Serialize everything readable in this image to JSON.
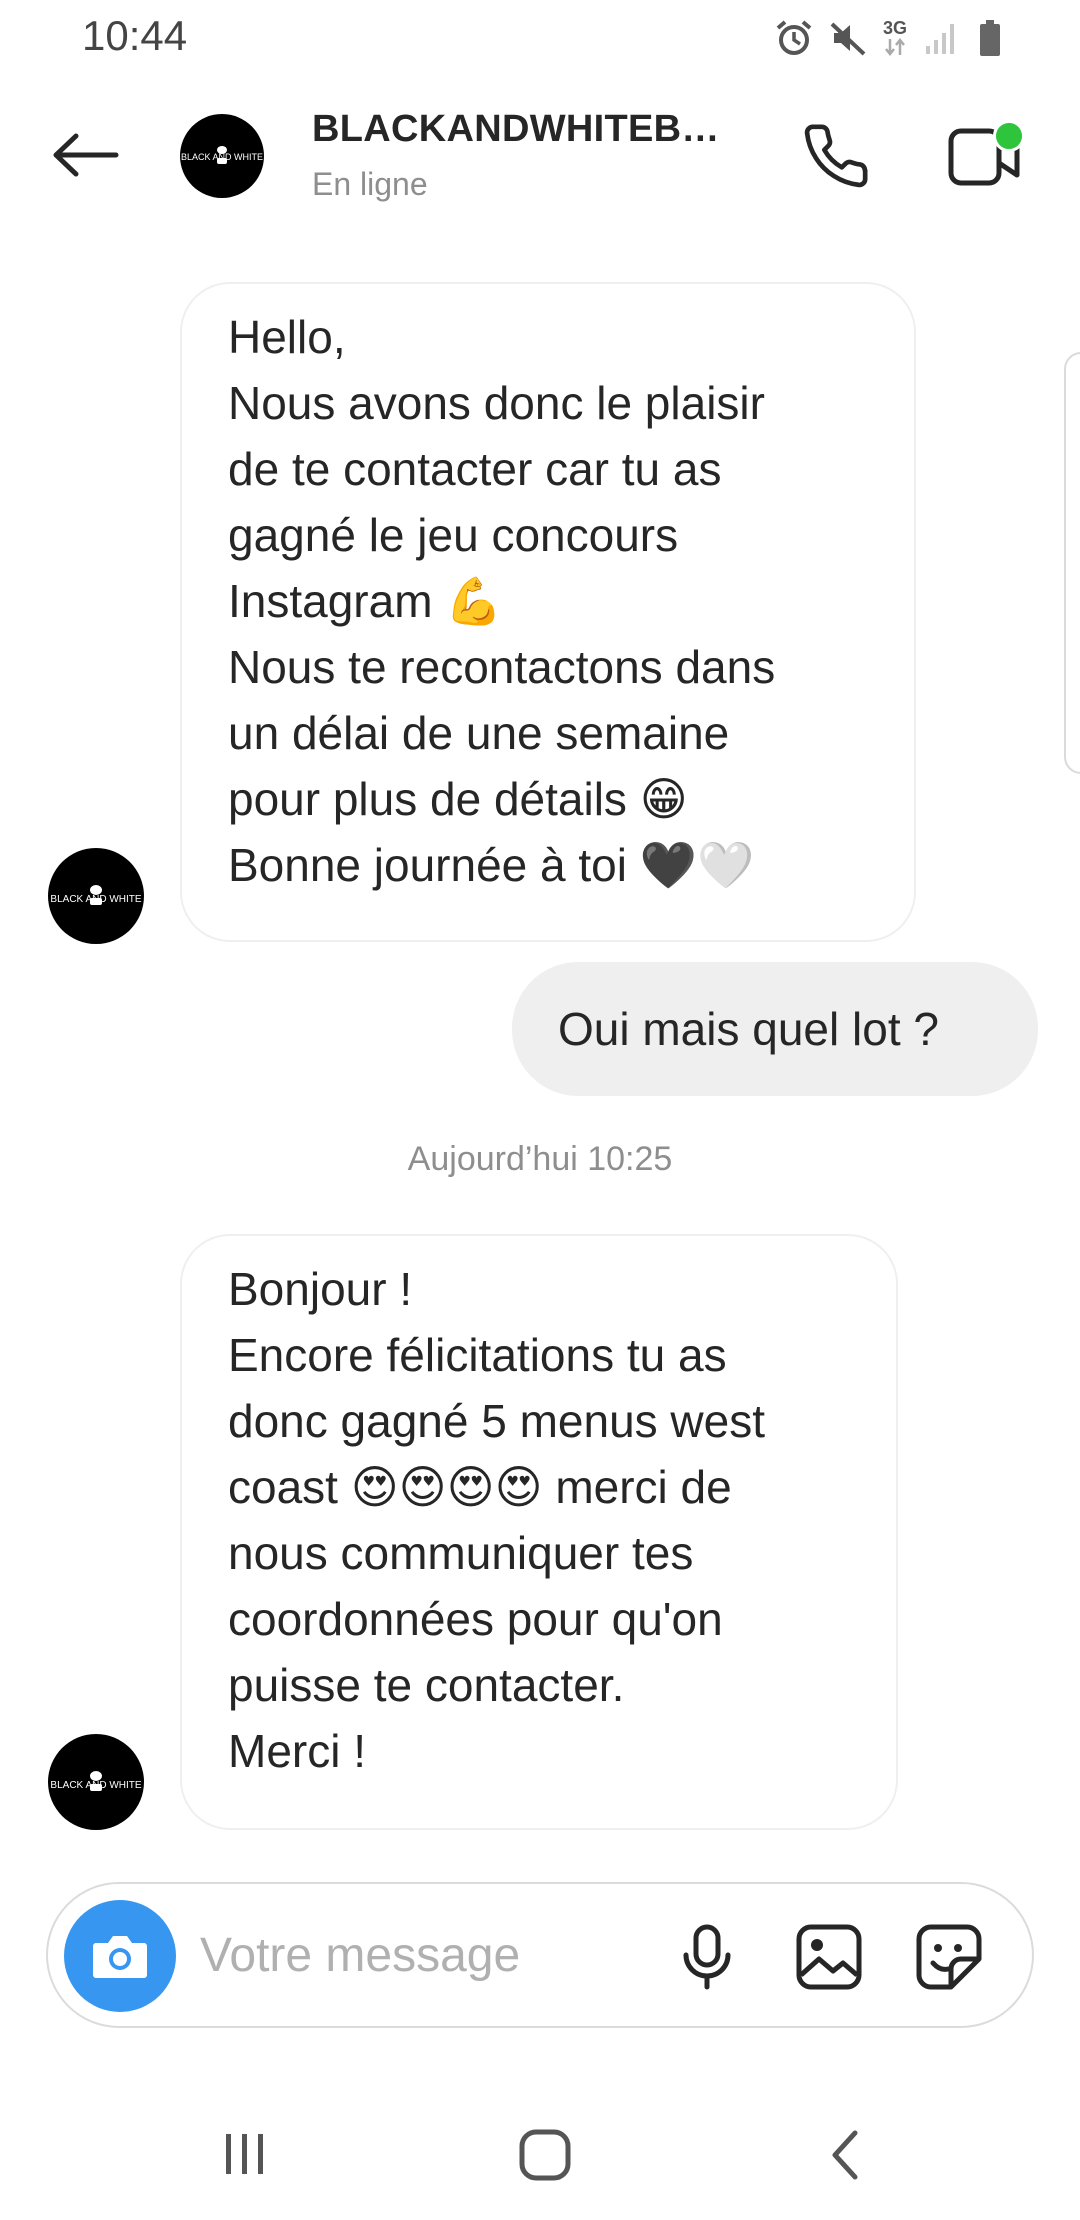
{
  "status_bar": {
    "time": "10:44",
    "network": "3G",
    "icons": [
      "alarm-icon",
      "mute-icon",
      "network-3g-icon",
      "signal-icon",
      "battery-icon"
    ]
  },
  "header": {
    "name": "BLACKANDWHITEB…",
    "status": "En ligne",
    "avatar_label": "BLACK AND WHITE",
    "icons": [
      "back-arrow-icon",
      "phone-icon",
      "video-camera-icon"
    ],
    "online_color": "#2ec43c"
  },
  "messages": [
    {
      "sender": "contact",
      "lines": [
        "Hello,",
        "Nous avons donc le plaisir",
        "de te contacter car tu as",
        "gagné le jeu concours",
        "Instagram 💪",
        "Nous te recontactons dans",
        "un délai de une semaine",
        "pour plus de détails 😁",
        "Bonne journée à toi 🖤🤍"
      ]
    },
    {
      "sender": "me",
      "text": "Oui mais quel lot ?"
    },
    {
      "sender": "contact",
      "lines": [
        "Bonjour !",
        "Encore félicitations tu as",
        "donc gagné 5 menus west",
        "coast 😍😍😍😍 merci de",
        "nous communiquer tes",
        "coordonnées  pour qu'on",
        "puisse te contacter.",
        "Merci !"
      ]
    }
  ],
  "timestamp": "Aujourd’hui 10:25",
  "composer": {
    "placeholder": "Votre message…",
    "value": "",
    "icons": [
      "camera-icon",
      "microphone-icon",
      "gallery-icon",
      "sticker-icon"
    ],
    "camera_color": "#3797f0"
  },
  "nav_bar": {
    "icons": [
      "recents-icon",
      "home-icon",
      "back-icon"
    ]
  }
}
